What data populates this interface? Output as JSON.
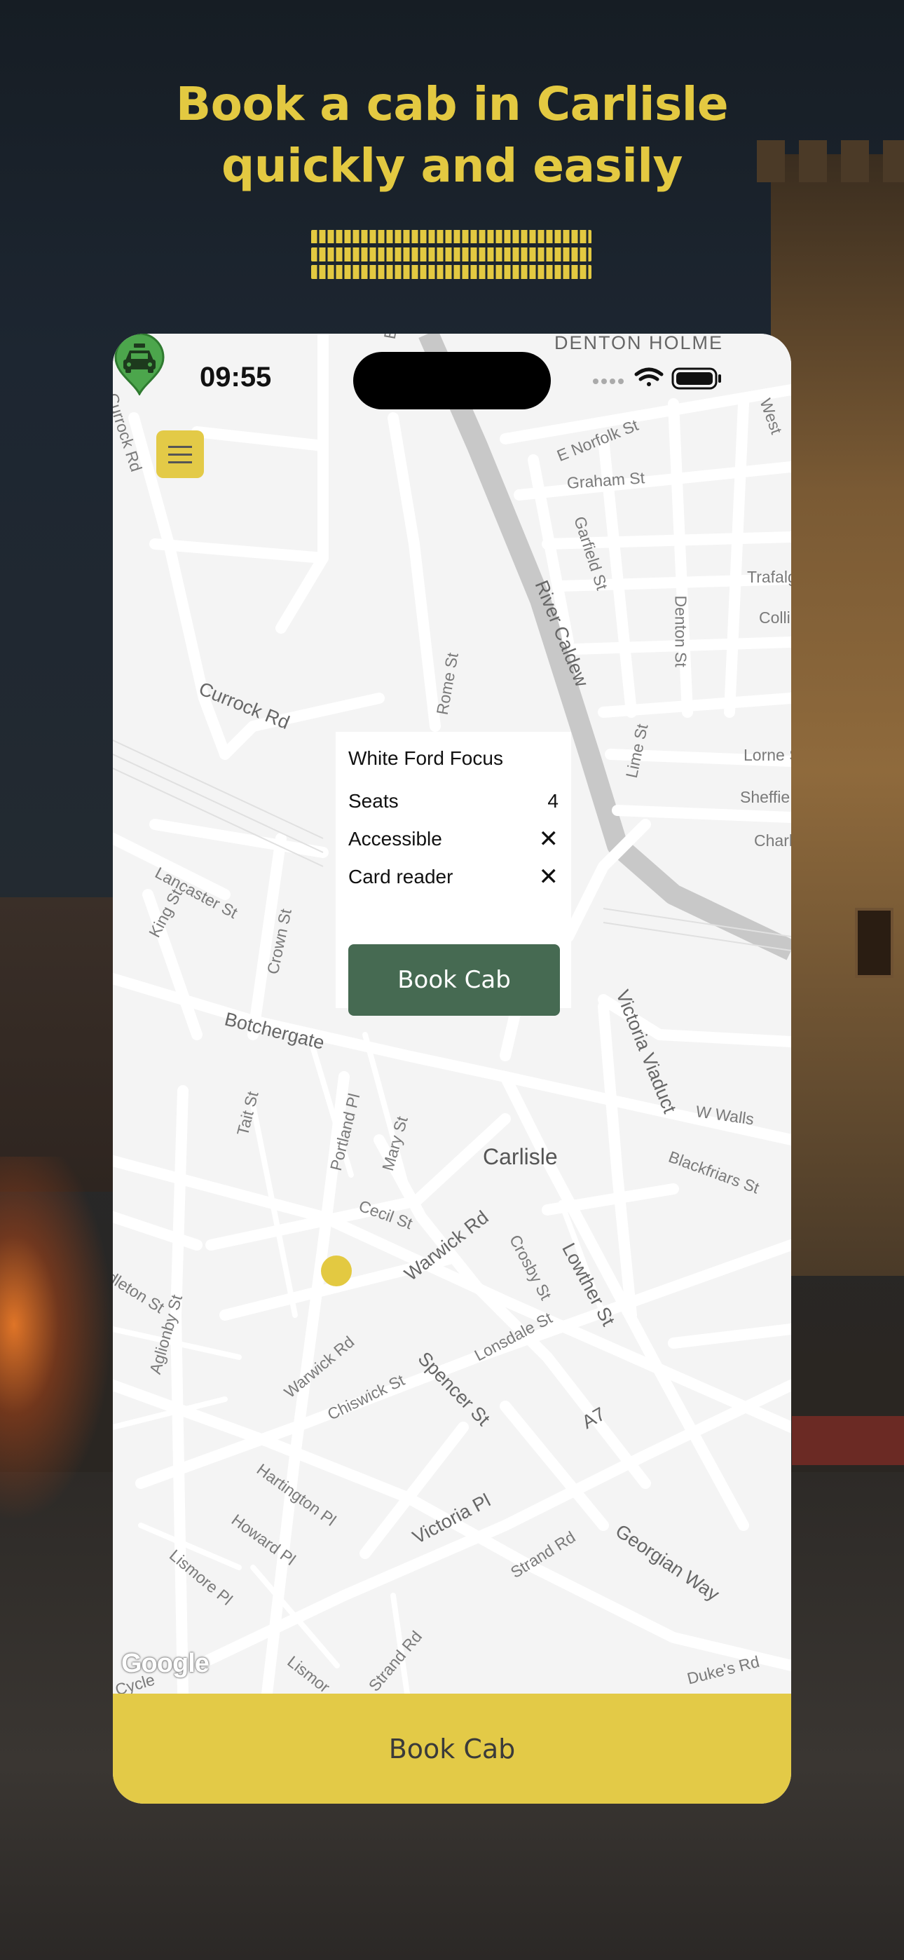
{
  "headline": {
    "line1": "Book a cab in Carlisle",
    "line2": "quickly and easily"
  },
  "status_bar": {
    "time": "09:55"
  },
  "map": {
    "labels": {
      "denton_holme": "DENTON HOLME",
      "currock_rd_top": "Currock Rd",
      "currock_rd": "Currock Rd",
      "e_norfolk_st": "E Norfolk St",
      "graham_st": "Graham St",
      "garfield_st": "Garfield St",
      "river_caldew": "River Caldew",
      "trafalgar": "Trafalg",
      "collingwood": "Collingwo",
      "denton_st": "Denton St",
      "rome_st": "Rome St",
      "lime_st": "Lime St",
      "lorne_st": "Lorne S",
      "sheffield": "Sheffie",
      "charles": "Charl",
      "lancaster_st": "Lancaster St",
      "king_st": "King St",
      "crown_st": "Crown St",
      "botchergate": "Botchergate",
      "victoria_viaduct": "Victoria Viaduct",
      "w_walls": "W Walls",
      "tait_st": "Tait St",
      "portland_pl": "Portland Pl",
      "mary_st": "Mary St",
      "carlisle": "Carlisle",
      "blackfriars_st": "Blackfriars St",
      "cecil_st": "Cecil St",
      "warwick_rd": "Warwick Rd",
      "crosby_st": "Crosby St",
      "lowther_st": "Lowther St",
      "dleton_st": "dleton St",
      "aglionby_st": "Aglionby St",
      "warwick_rd_small": "Warwick Rd",
      "spencer_st": "Spencer St",
      "lonsdale_st": "Lonsdale St",
      "chiswick_st": "Chiswick St",
      "a7": "A7",
      "hartington_pl": "Hartington Pl",
      "howard_pl": "Howard Pl",
      "victoria_pl": "Victoria Pl",
      "georgian_way": "Georgian Way",
      "strand_rd": "Strand Rd",
      "lismore_pl": "Lismore Pl",
      "lismore": "Lismor",
      "strand_rd_2": "Strand Rd",
      "dukes_rd": "Duke's Rd",
      "cycle": "Cycle",
      "west": "West",
      "bo": "Bo"
    },
    "attribution": "Google"
  },
  "popup": {
    "vehicle": "White Ford Focus",
    "rows": [
      {
        "label": "Seats",
        "value": "4"
      },
      {
        "label": "Accessible",
        "value": "✕"
      },
      {
        "label": "Card reader",
        "value": "✕"
      }
    ],
    "button_label": "Book Cab"
  },
  "bottom_button": {
    "label": "Book Cab"
  },
  "colors": {
    "accent_yellow": "#e3c941",
    "button_green": "#466a52",
    "pin_green": "#4ca64c",
    "map_bg": "#f4f4f4",
    "road": "#ffffff",
    "river": "#c4c4c4"
  },
  "icons": [
    "menu-icon",
    "taxi-pin-icon",
    "wifi-icon",
    "battery-icon",
    "signal-icon",
    "close-icon"
  ]
}
